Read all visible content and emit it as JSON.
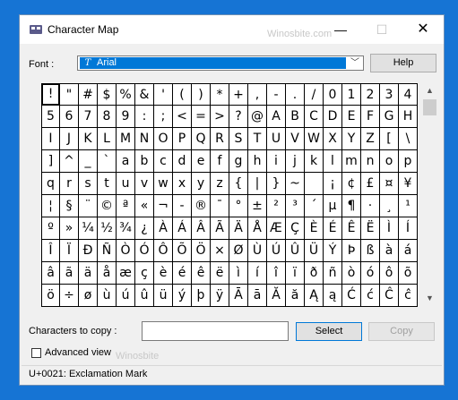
{
  "window": {
    "title": "Character Map",
    "watermark": "Winosbite.com",
    "watermark2": "Winosbite"
  },
  "titlebar": {
    "minimize": "—",
    "maximize": "☐",
    "close": "✕"
  },
  "font": {
    "label": "Font :",
    "selected": "Arial",
    "icon": "T"
  },
  "buttons": {
    "help": "Help",
    "select": "Select",
    "copy": "Copy"
  },
  "grid": {
    "rows": [
      [
        "!",
        "\"",
        "#",
        "$",
        "%",
        "&",
        "'",
        "(",
        ")",
        "*",
        "+",
        ",",
        "-",
        ".",
        "/",
        "0",
        "1",
        "2",
        "3",
        "4"
      ],
      [
        "5",
        "6",
        "7",
        "8",
        "9",
        ":",
        ";",
        "<",
        "=",
        ">",
        "?",
        "@",
        "A",
        "B",
        "C",
        "D",
        "E",
        "F",
        "G",
        "H"
      ],
      [
        "I",
        "J",
        "K",
        "L",
        "M",
        "N",
        "O",
        "P",
        "Q",
        "R",
        "S",
        "T",
        "U",
        "V",
        "W",
        "X",
        "Y",
        "Z",
        "[",
        "\\"
      ],
      [
        "]",
        "^",
        "_",
        "`",
        "a",
        "b",
        "c",
        "d",
        "e",
        "f",
        "g",
        "h",
        "i",
        "j",
        "k",
        "l",
        "m",
        "n",
        "o",
        "p"
      ],
      [
        "q",
        "r",
        "s",
        "t",
        "u",
        "v",
        "w",
        "x",
        "y",
        "z",
        "{",
        "|",
        "}",
        "~",
        " ",
        "¡",
        "¢",
        "£",
        "¤",
        "¥"
      ],
      [
        "¦",
        "§",
        "¨",
        "©",
        "ª",
        "«",
        "¬",
        "-",
        "®",
        "¯",
        "°",
        "±",
        "²",
        "³",
        "´",
        "µ",
        "¶",
        "·",
        "¸",
        "¹"
      ],
      [
        "º",
        "»",
        "¼",
        "½",
        "¾",
        "¿",
        "À",
        "Á",
        "Â",
        "Ã",
        "Ä",
        "Å",
        "Æ",
        "Ç",
        "È",
        "É",
        "Ê",
        "Ë",
        "Ì",
        "Í"
      ],
      [
        "Î",
        "Ï",
        "Ð",
        "Ñ",
        "Ò",
        "Ó",
        "Ô",
        "Õ",
        "Ö",
        "×",
        "Ø",
        "Ù",
        "Ú",
        "Û",
        "Ü",
        "Ý",
        "Þ",
        "ß",
        "à",
        "á"
      ],
      [
        "â",
        "ã",
        "ä",
        "å",
        "æ",
        "ç",
        "è",
        "é",
        "ê",
        "ë",
        "ì",
        "í",
        "î",
        "ï",
        "ð",
        "ñ",
        "ò",
        "ó",
        "ô",
        "õ"
      ],
      [
        "ö",
        "÷",
        "ø",
        "ù",
        "ú",
        "û",
        "ü",
        "ý",
        "þ",
        "ÿ",
        "Ā",
        "ā",
        "Ă",
        "ă",
        "Ą",
        "ą",
        "Ć",
        "ć",
        "Ĉ",
        "ĉ"
      ]
    ]
  },
  "scrollbar": {
    "up": "▲",
    "down": "▼"
  },
  "copy": {
    "label": "Characters to copy :",
    "value": ""
  },
  "advanced": {
    "label": "Advanced view"
  },
  "status": {
    "text": "U+0021: Exclamation Mark"
  }
}
